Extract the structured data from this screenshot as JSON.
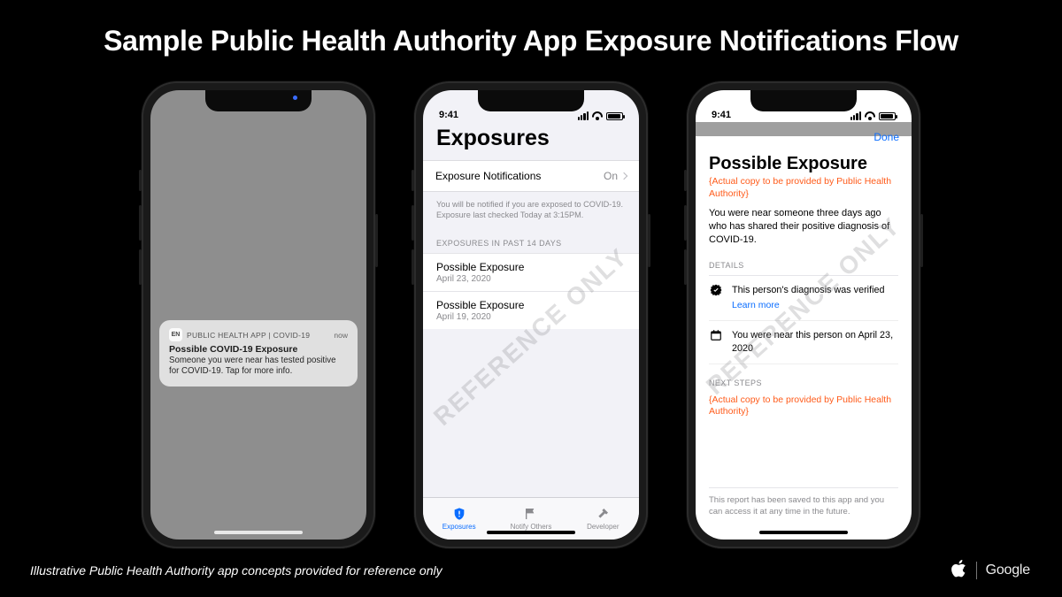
{
  "slide": {
    "title": "Sample Public Health Authority App Exposure Notifications Flow",
    "caption": "Illustrative Public Health Authority app concepts provided for reference only",
    "watermark": "REFERENCE ONLY",
    "logos": {
      "apple": "",
      "google": "Google"
    }
  },
  "phone1": {
    "notification": {
      "app_icon_label": "EN",
      "app_name": "PUBLIC HEALTH APP | COVID-19",
      "time": "now",
      "title": "Possible COVID-19 Exposure",
      "body": "Someone you were near has tested positive for COVID-19. Tap for more info."
    }
  },
  "phone2": {
    "status_time": "9:41",
    "title": "Exposures",
    "toggle_row": {
      "label": "Exposure Notifications",
      "value": "On"
    },
    "hint": "You will be notified if you are exposed to COVID-19. Exposure last checked Today at 3:15PM.",
    "section_header": "EXPOSURES IN PAST 14 DAYS",
    "items": [
      {
        "title": "Possible Exposure",
        "date": "April 23, 2020"
      },
      {
        "title": "Possible Exposure",
        "date": "April 19, 2020"
      }
    ],
    "tabs": [
      {
        "label": "Exposures"
      },
      {
        "label": "Notify Others"
      },
      {
        "label": "Developer"
      }
    ]
  },
  "phone3": {
    "status_time": "9:41",
    "done": "Done",
    "title": "Possible Exposure",
    "placeholder_top": "{Actual copy to be provided by Public Health Authority}",
    "para": "You were near someone three days ago who has shared their positive diagnosis of COVID-19.",
    "details_header": "DETAILS",
    "detail_verified": "This person's diagnosis was verified",
    "learn_more": "Learn more",
    "detail_date": "You were near this person on April 23, 2020",
    "next_header": "NEXT STEPS",
    "placeholder_next": "{Actual copy to be provided by Public Health Authority}",
    "footnote": "This report has been saved to this app and you can access it at any time in the future."
  }
}
